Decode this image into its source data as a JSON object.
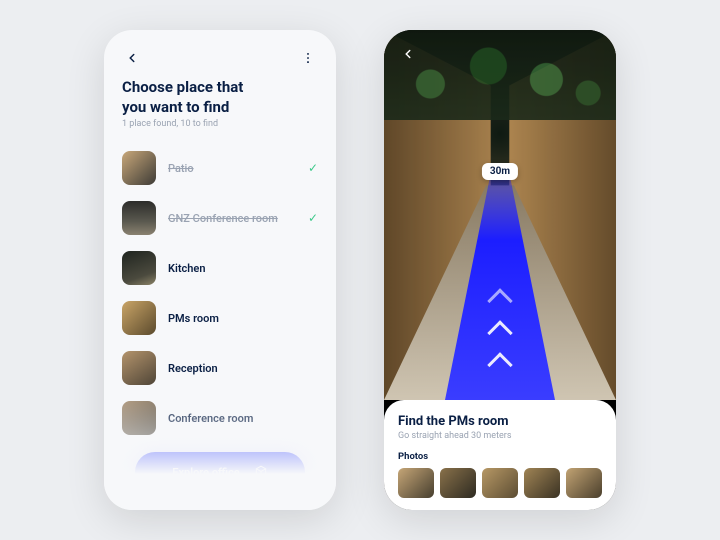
{
  "left": {
    "title": "Choose place that you want to find",
    "subtitle": "1 place found, 10 to find",
    "items": [
      {
        "label": "Patio",
        "done": true
      },
      {
        "label": "GNZ Conference room",
        "done": true
      },
      {
        "label": "Kitchen",
        "done": false
      },
      {
        "label": "PMs room",
        "done": false
      },
      {
        "label": "Reception",
        "done": false
      },
      {
        "label": "Conference room",
        "done": false
      }
    ],
    "cta": "Explore office"
  },
  "right": {
    "distance_badge": "30m",
    "sheet_title": "Find the PMs room",
    "direction": "Go straight ahead 30 meters",
    "photos_label": "Photos",
    "photo_count": 5
  },
  "colors": {
    "primary": "#1c2fff",
    "text": "#0a1f44",
    "muted": "#9aa3b2",
    "success": "#3dc98a"
  }
}
